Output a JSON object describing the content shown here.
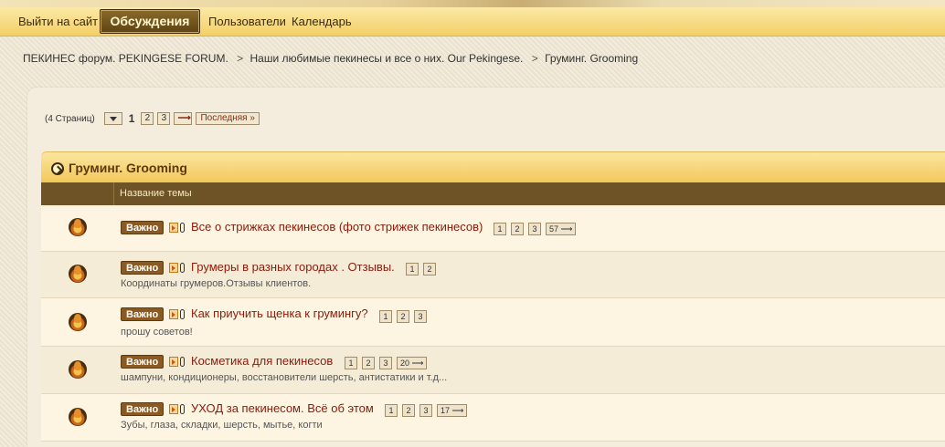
{
  "nav": {
    "items": [
      "Выйти на сайт",
      "Обсуждения",
      "Пользователи",
      "Календарь"
    ]
  },
  "breadcrumb": [
    "ПЕКИНЕС форум. PEKINGESE FORUM.",
    "Наши любимые пекинесы и все о них. Our  Pekingese.",
    "Груминг. Grooming"
  ],
  "breadcrumb_sep": ">",
  "pagination": {
    "label": "(4 Страниц)",
    "current": "1",
    "pages": [
      "2",
      "3"
    ],
    "next": "⟶",
    "last": "Последняя »"
  },
  "forum": {
    "title": "Груминг. Grooming",
    "column": "Название темы"
  },
  "topics": [
    {
      "badge": "Важно",
      "title": "Все о стрижках пекинесов (фото стрижек пекинесов)",
      "pages": [
        "1",
        "2",
        "3",
        "57 ⟶"
      ],
      "desc": ""
    },
    {
      "badge": "Важно",
      "title": "Грумеры в разных городах . Отзывы.",
      "pages": [
        "1",
        "2"
      ],
      "desc": "Координаты грумеров.Отзывы клиентов."
    },
    {
      "badge": "Важно",
      "title": "Как приучить щенка к грумингу?",
      "pages": [
        "1",
        "2",
        "3"
      ],
      "desc": "прошу советов!"
    },
    {
      "badge": "Важно",
      "title": "Косметика для пекинесов",
      "pages": [
        "1",
        "2",
        "3",
        "20 ⟶"
      ],
      "desc": "шампуни, кондиционеры, восстановители шерсть, антистатики и т.д..."
    },
    {
      "badge": "Важно",
      "title": "УХОД за пекинесом. Всё об этом",
      "pages": [
        "1",
        "2",
        "3",
        "17 ⟶"
      ],
      "desc": "Зубы, глаза, складки, шерсть, мытье, когти"
    }
  ],
  "colors": {
    "nav_gradient_top": "#fbe9a6",
    "nav_gradient_bottom": "#f3cf66",
    "active_tab": "#6e5120",
    "badge": "#8a5a22",
    "topic_link": "#8a1a0a",
    "column_header": "#6d5326"
  }
}
